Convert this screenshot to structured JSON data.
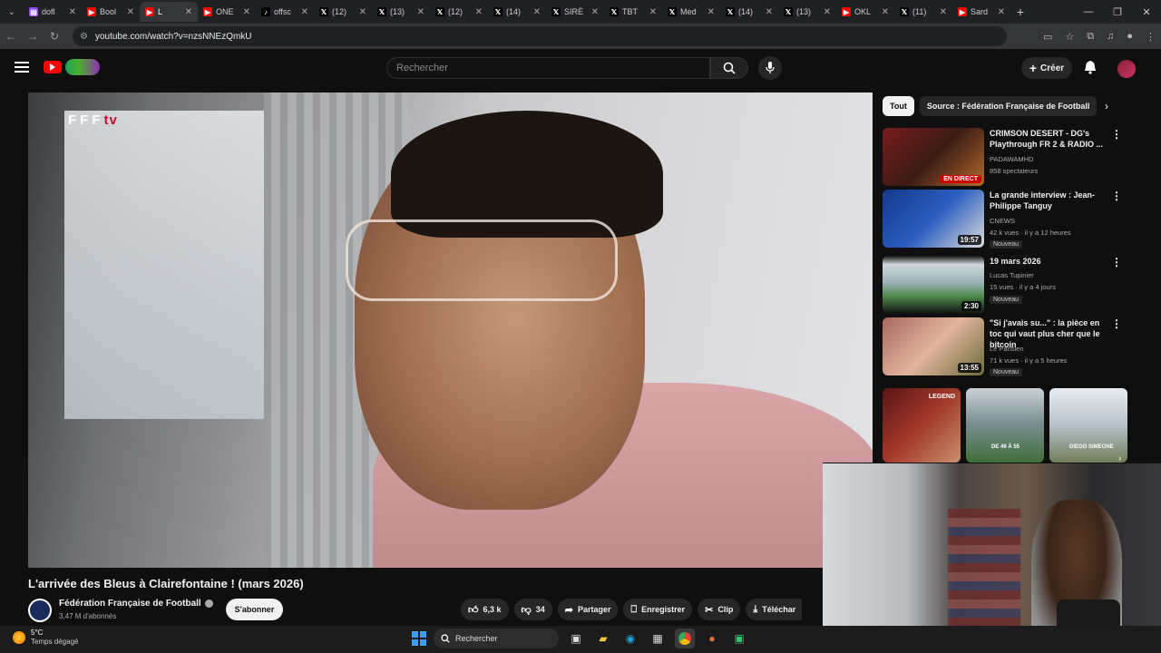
{
  "browser": {
    "tabs": [
      {
        "label": "dofl",
        "favicon": "twitch",
        "active": false
      },
      {
        "label": "Bool",
        "favicon": "youtube",
        "active": false
      },
      {
        "label": "L",
        "favicon": "youtube",
        "active": true
      },
      {
        "label": "ONE",
        "favicon": "youtube",
        "active": false
      },
      {
        "label": "offsc",
        "favicon": "tiktok",
        "active": false
      },
      {
        "label": "(12)",
        "favicon": "x",
        "active": false
      },
      {
        "label": "(13)",
        "favicon": "x",
        "active": false
      },
      {
        "label": "(12)",
        "favicon": "x",
        "active": false
      },
      {
        "label": "(14)",
        "favicon": "x",
        "active": false
      },
      {
        "label": "SIRÈ",
        "favicon": "x",
        "active": false
      },
      {
        "label": "TBT",
        "favicon": "x",
        "active": false
      },
      {
        "label": "Med",
        "favicon": "x",
        "active": false
      },
      {
        "label": "(14)",
        "favicon": "x",
        "active": false
      },
      {
        "label": "(13)",
        "favicon": "x",
        "active": false
      },
      {
        "label": "OKL",
        "favicon": "youtube",
        "active": false
      },
      {
        "label": "(11)",
        "favicon": "x",
        "active": false
      },
      {
        "label": "Sard",
        "favicon": "youtube",
        "active": false
      }
    ],
    "url": "youtube.com/watch?v=nzsNNEzQmkU"
  },
  "youtube": {
    "search_placeholder": "Rechercher",
    "create_label": "Créer",
    "video_overlay_logo": "FFF",
    "video_overlay_logo_suffix": "tv",
    "video_title": "L'arrivée des Bleus à Clairefontaine ! (mars 2026)",
    "channel_name": "Fédération Française de Football",
    "channel_subs": "3,47 M d'abonnés",
    "subscribe_label": "S'abonner",
    "likes": "6,3 k",
    "dislikes": "34",
    "share_label": "Partager",
    "save_label": "Enregistrer",
    "clip_label": "Clip",
    "download_label": "Téléchar",
    "chips": [
      "Tout",
      "Source : Fédération Française de Football"
    ],
    "recommendations": [
      {
        "title": "CRIMSON DESERT - DG's Playthrough FR 2 & RADIO ...",
        "channel": "PADAWAMHD",
        "stats": "858 spectateurs",
        "overlay": "EN DIRECT",
        "badge": ""
      },
      {
        "title": "La grande interview : Jean-Philippe Tanguy",
        "channel": "CNEWS",
        "stats": "42 k vues · il y a 12 heures",
        "overlay": "19:57",
        "badge": "Nouveau"
      },
      {
        "title": "19 mars 2026",
        "channel": "Lucas Tupinier",
        "stats": "15 vues · il y a 4 jours",
        "overlay": "2:30",
        "badge": "Nouveau"
      },
      {
        "title": "\"Si j'avais su...\" : la pièce en toc qui vaut plus cher que le bitcoin",
        "channel": "Le Parisien",
        "stats": "71 k vues · il y a 5 heures",
        "overlay": "13:55",
        "badge": "Nouveau"
      }
    ],
    "shorts_text": [
      "LEGEND",
      "DE 49 À 55",
      "DIEGO SIMEONE"
    ]
  },
  "taskbar": {
    "temperature": "5°C",
    "weather": "Temps dégagé",
    "search_label": "Rechercher"
  }
}
